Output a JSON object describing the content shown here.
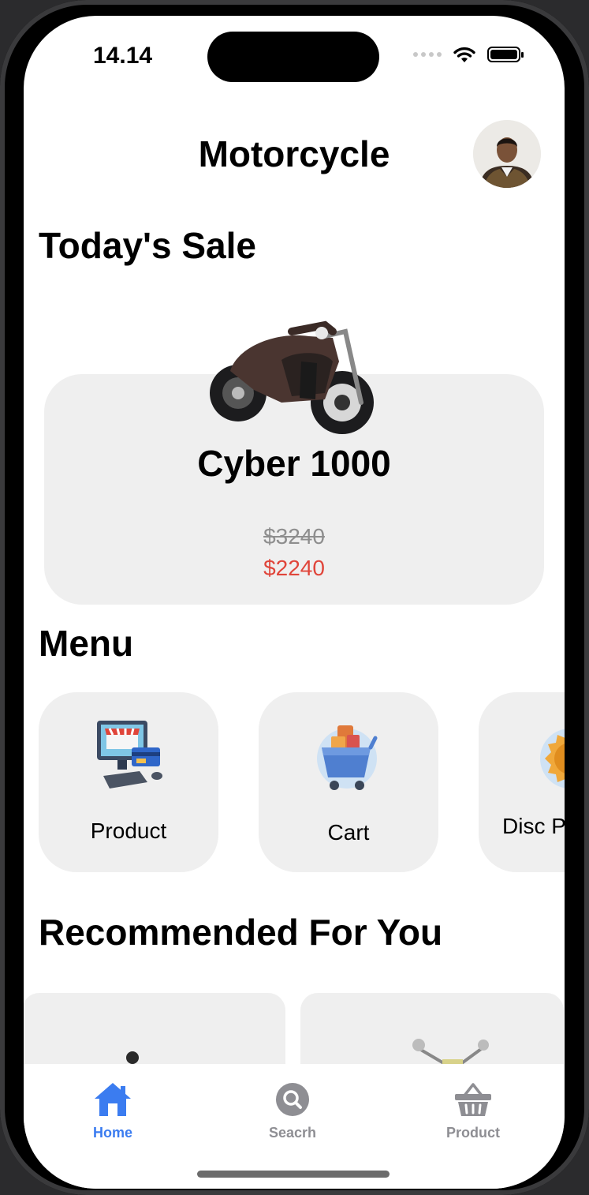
{
  "status_bar": {
    "time": "14.14"
  },
  "header": {
    "title": "Motorcycle"
  },
  "todays_sale": {
    "heading": "Today's Sale",
    "product_name": "Cyber 1000",
    "old_price": "$3240",
    "new_price": "$2240"
  },
  "menu": {
    "heading": "Menu",
    "items": [
      {
        "label": "Product",
        "icon": "computer-shop-icon"
      },
      {
        "label": "Cart",
        "icon": "shopping-cart-icon"
      },
      {
        "label": "Disc P",
        "icon": "discount-badge-icon"
      }
    ]
  },
  "recommended": {
    "heading": "Recommended For You"
  },
  "tab_bar": {
    "items": [
      {
        "label": "Home",
        "icon": "home-icon",
        "active": true
      },
      {
        "label": "Seacrh",
        "icon": "search-icon",
        "active": false
      },
      {
        "label": "Product",
        "icon": "basket-icon",
        "active": false
      }
    ]
  },
  "colors": {
    "accent": "#3b7cf0",
    "sale_price": "#e0453a",
    "inactive": "#8e8e93",
    "card_bg": "#efefef"
  }
}
